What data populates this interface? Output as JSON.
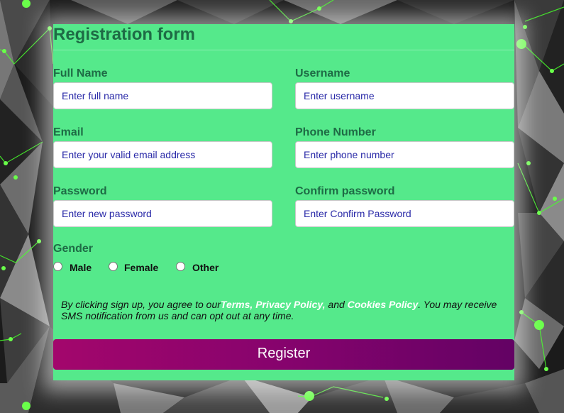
{
  "form": {
    "title": "Registration form",
    "fields": [
      {
        "label": "Full Name",
        "placeholder": "Enter full name"
      },
      {
        "label": "Username",
        "placeholder": "Enter username"
      },
      {
        "label": "Email",
        "placeholder": "Enter your valid email address"
      },
      {
        "label": "Phone Number",
        "placeholder": "Enter phone number"
      },
      {
        "label": "Password",
        "placeholder": "Enter new password"
      },
      {
        "label": "Confirm password",
        "placeholder": "Enter Confirm Password"
      }
    ],
    "gender": {
      "label": "Gender",
      "options": [
        "Male",
        "Female",
        "Other"
      ]
    },
    "terms": {
      "prefix": "By clicking sign up, you agree to our",
      "terms_link": "Terms, ",
      "privacy_link": "Privacy Policy,",
      "and": " and ",
      "cookies_link": "Cookies Policy",
      "suffix": ". You may receive SMS notification from us and can opt out at any time."
    },
    "register_label": "Register"
  },
  "colors": {
    "card_bg": "#55e98b",
    "label": "#1e6b45",
    "button_start": "#a3066c",
    "button_end": "#630264",
    "node_glow": "#4dff3a"
  }
}
